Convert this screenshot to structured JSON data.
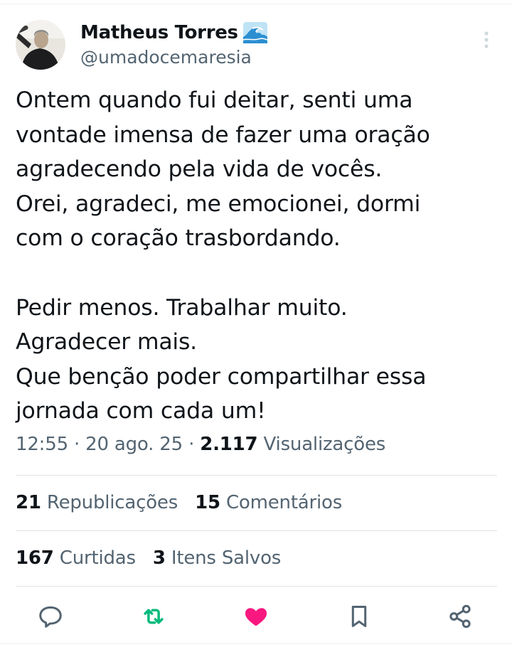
{
  "author": {
    "name": "Matheus Torres",
    "handle": "@umadocemaresia",
    "emoji_icon": "water-wave-icon"
  },
  "tweet": {
    "text": "Ontem quando fui deitar, senti uma\nvontade imensa de fazer uma oração\nagradecendo pela vida de vocês.\nOrei, agradeci, me emocionei, dormi\ncom o coração trasbordando.\n\nPedir menos. Trabalhar muito.\nAgradecer mais.\nQue benção poder compartilhar essa\njornada com cada um!"
  },
  "meta": {
    "time": "12:55",
    "sep1": " · ",
    "date": "20 ago. 25",
    "sep2": " · ",
    "views_count": "2.117",
    "views_label": "Visualizações"
  },
  "stats": {
    "reposts_count": "21",
    "reposts_label": "Republicações",
    "comments_count": "15",
    "comments_label": "Comentários",
    "likes_count": "167",
    "likes_label": "Curtidas",
    "saves_count": "3",
    "saves_label": "Itens Salvos"
  },
  "actions": {
    "reply_icon": "reply-icon",
    "repost_icon": "repost-icon",
    "like_icon": "heart-icon",
    "bookmark_icon": "bookmark-icon",
    "share_icon": "share-icon"
  },
  "colors": {
    "text": "#0f1419",
    "secondary": "#536471",
    "repost_green": "#00ba7c",
    "like_pink": "#f91880",
    "divider": "#dfe3e6"
  }
}
